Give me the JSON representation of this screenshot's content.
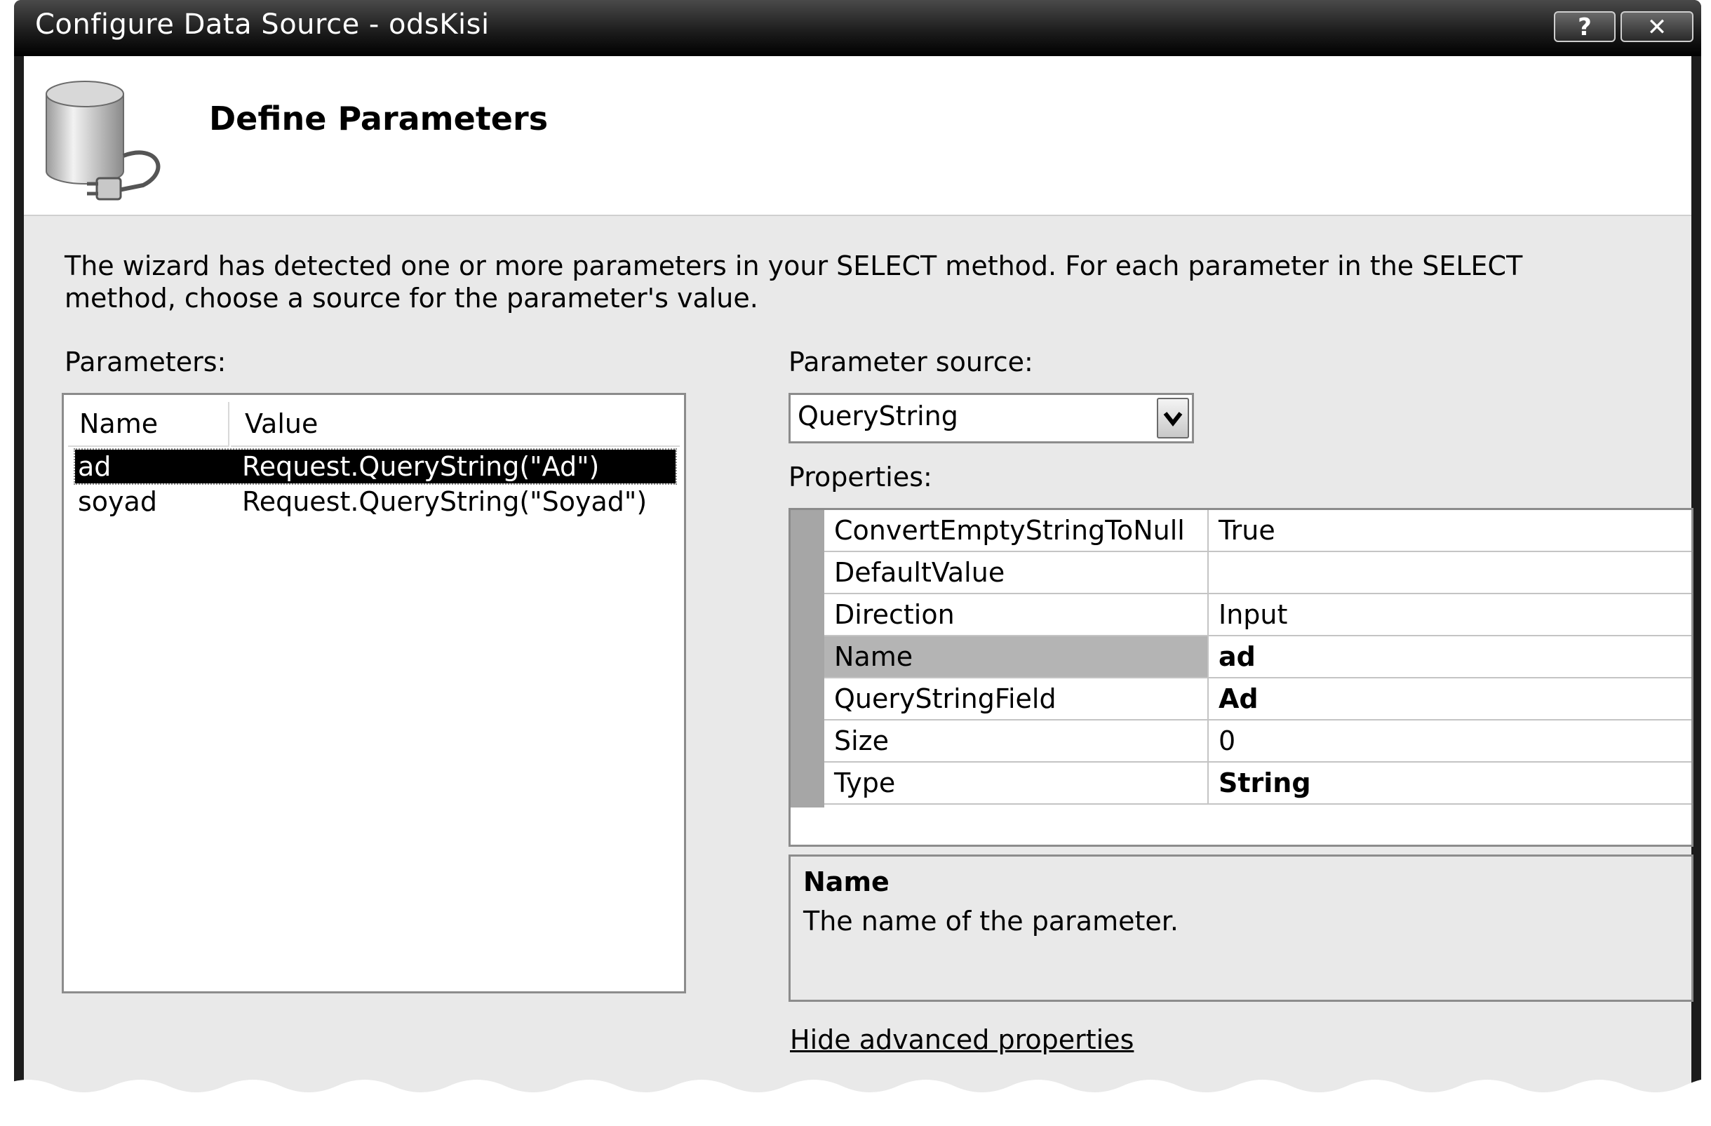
{
  "window": {
    "title": "Configure Data Source - odsKisi",
    "help_label": "?",
    "close_label": "✕"
  },
  "header": {
    "heading": "Define Parameters",
    "icon": "database-plug-icon"
  },
  "intro_text": "The wizard has detected one or more parameters in your SELECT method. For each parameter in the SELECT method, choose a source for the parameter's value.",
  "parameters": {
    "label": "Parameters:",
    "columns": [
      "Name",
      "Value"
    ],
    "rows": [
      {
        "name": "ad",
        "value": "Request.QueryString(\"Ad\")",
        "selected": true
      },
      {
        "name": "soyad",
        "value": "Request.QueryString(\"Soyad\")",
        "selected": false
      }
    ]
  },
  "parameter_source": {
    "label": "Parameter source:",
    "selected": "QueryString"
  },
  "properties": {
    "label": "Properties:",
    "rows": [
      {
        "name": "ConvertEmptyStringToNull",
        "value": "True"
      },
      {
        "name": "DefaultValue",
        "value": ""
      },
      {
        "name": "Direction",
        "value": "Input"
      },
      {
        "name": "Name",
        "value": "ad"
      },
      {
        "name": "QueryStringField",
        "value": "Ad"
      },
      {
        "name": "Size",
        "value": "0"
      },
      {
        "name": "Type",
        "value": "String"
      }
    ]
  },
  "description": {
    "title": "Name",
    "text": "The name of the parameter."
  },
  "advanced_link": "Hide advanced properties"
}
